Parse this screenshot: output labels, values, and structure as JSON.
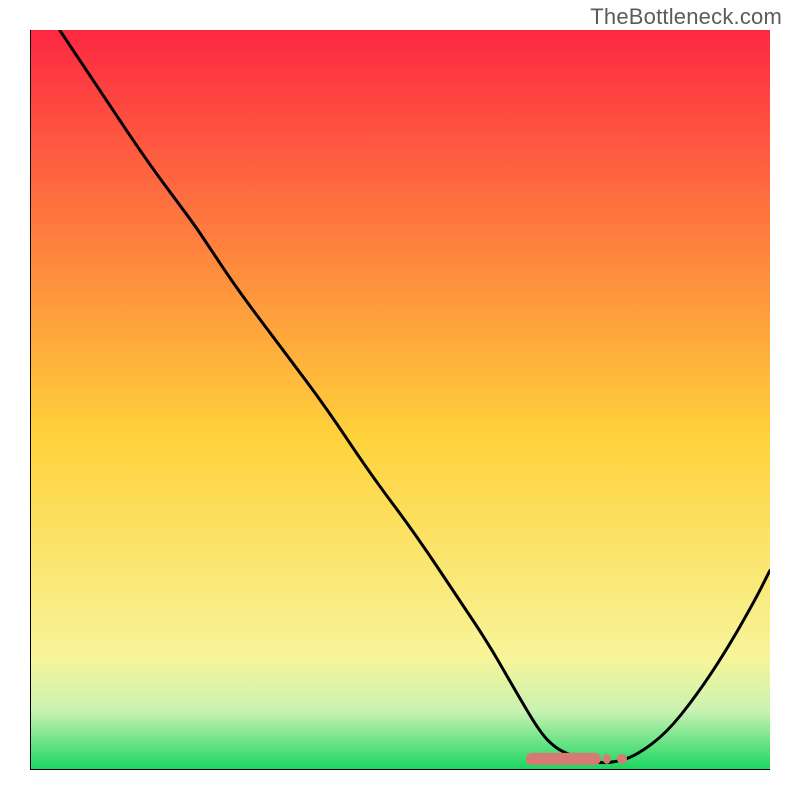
{
  "watermark": "TheBottleneck.com",
  "colors": {
    "gradient_top": "#fd2842",
    "gradient_mid": "#ffd23a",
    "gradient_low": "#f7f59a",
    "gradient_bottom": "#18d65f",
    "curve": "#000000",
    "marker": "#d87a74",
    "axis": "#000000"
  },
  "chart_data": {
    "type": "line",
    "title": "",
    "xlabel": "",
    "ylabel": "",
    "xlim": [
      0,
      100
    ],
    "ylim": [
      0,
      100
    ],
    "grid": false,
    "legend": false,
    "annotations": [
      "TheBottleneck.com"
    ],
    "series": [
      {
        "name": "bottleneck-curve",
        "x": [
          4,
          10,
          16,
          22,
          24,
          28,
          34,
          40,
          46,
          52,
          58,
          62,
          66,
          69,
          71,
          73,
          76,
          79,
          82,
          86,
          90,
          94,
          98,
          100
        ],
        "y": [
          100,
          91,
          82,
          74,
          71,
          65,
          57,
          49,
          40,
          32,
          23,
          17,
          10,
          5,
          3,
          2,
          1,
          1,
          2,
          5,
          10,
          16,
          23,
          27
        ]
      }
    ],
    "marker": {
      "name": "optimum-range",
      "x_start": 67,
      "x_end": 80,
      "y": 1.5
    }
  }
}
